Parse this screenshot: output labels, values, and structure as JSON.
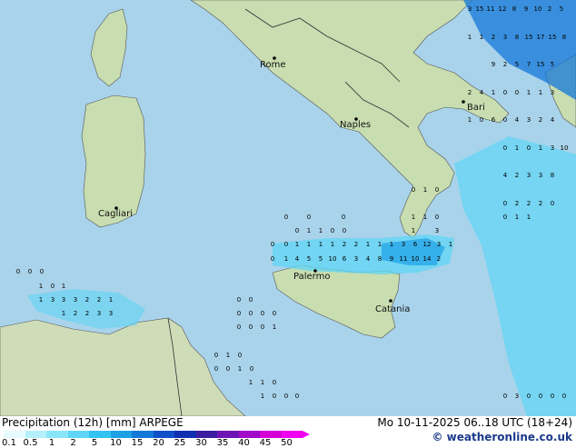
{
  "title": "Precipitation (12h) [mm] ARPEGE",
  "valid_time": "Mo 10-11-2025 06..18 UTC (18+24)",
  "credit": "© weatheronline.co.uk",
  "cities": [
    {
      "name": "Rome"
    },
    {
      "name": "Naples"
    },
    {
      "name": "Bari"
    },
    {
      "name": "Cagliari"
    },
    {
      "name": "Palermo"
    },
    {
      "name": "Catania"
    }
  ],
  "legend": {
    "ticks": [
      "0.1",
      "0.5",
      "1",
      "2",
      "5",
      "10",
      "15",
      "20",
      "25",
      "30",
      "35",
      "40",
      "45",
      "50"
    ],
    "colors": [
      "#e6fbff",
      "#b4f0fb",
      "#8be5f8",
      "#5fd6f5",
      "#33c3f0",
      "#1ea0e6",
      "#1478d8",
      "#1050c8",
      "#1030b0",
      "#3c1ea0",
      "#6e14b4",
      "#a00ac8",
      "#d400d8",
      "#f000f0"
    ]
  },
  "colors": {
    "sea": "#a9d3ea",
    "land": "#c8ddb0",
    "africa": "#cfdcb8",
    "border": "#333333"
  }
}
